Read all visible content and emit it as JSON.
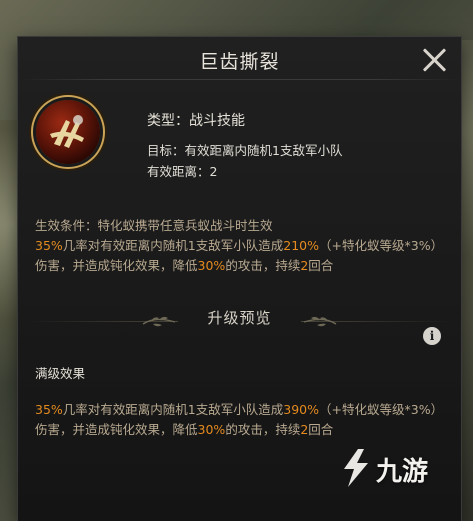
{
  "dialog": {
    "title": "巨齿撕裂"
  },
  "skill": {
    "icon": "claw-slash-icon",
    "type_line": "类型：战斗技能",
    "target_line": "目标：有效距离内随机1支敌军小队",
    "range_line": "有效距离：2"
  },
  "effect": {
    "condition": "生效条件：特化蚁携带任意兵蚁战斗时生效",
    "desc_parts": {
      "p1": "35%",
      "p2": "几率对有效距离内随机1支敌军小队造成",
      "p3": "210%",
      "p4": "（+特化蚁等级*3%）伤害，并造成钝化效果，降低",
      "p5": "30%",
      "p6": "的攻击，持续",
      "p7": "2",
      "p8": "回合"
    }
  },
  "upgrade": {
    "section_title": "升级预览",
    "max_label": "满级效果",
    "desc_parts": {
      "p1": "35%",
      "p2": "几率对有效距离内随机1支敌军小队造成",
      "p3": "390%",
      "p4": "（+特化蚁等级*3%）伤害，并造成钝化效果，降低",
      "p5": "30%",
      "p6": "的攻击，持续",
      "p7": "2",
      "p8": "回合"
    }
  },
  "watermark": {
    "text": "九游"
  },
  "colors": {
    "highlight": "#e48a1f",
    "body_text": "#b8a990",
    "icon_ring": "#c9a458"
  }
}
